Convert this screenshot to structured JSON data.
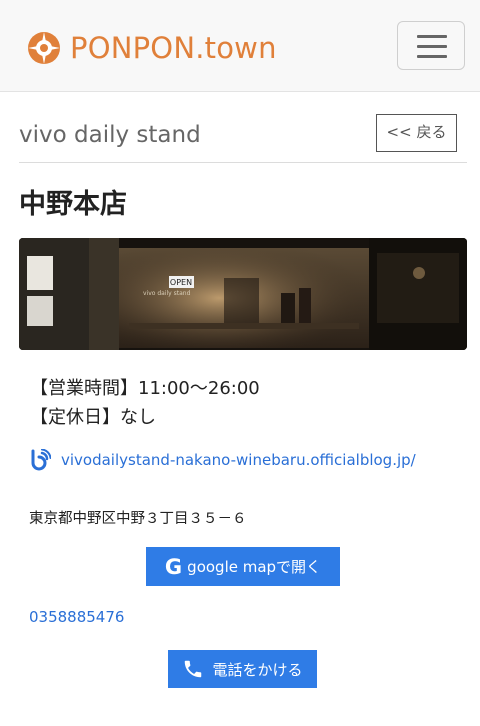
{
  "header": {
    "brand": "PONPON.town",
    "menu_icon": "hamburger-icon",
    "brand_color": "#e0803a"
  },
  "shop": {
    "name": "vivo daily stand",
    "back_label": "<< 戻る",
    "branch": "中野本店"
  },
  "info": {
    "hours": "【営業時間】11:00〜26:00",
    "closed": "【定休日】なし",
    "blog_url": "vivodailystand-nakano-winebaru.officialblog.jp/",
    "blog_icon": "blog-icon",
    "address": "東京都中野区中野３丁目３５－６",
    "map_button": "google mapで開く",
    "map_icon": "google-g-icon",
    "phone": "0358885476",
    "call_button": "電話をかける",
    "phone_icon": "phone-icon"
  },
  "photo_texts": {
    "open_sign": "OPEN",
    "window_text": "vivo daily stand"
  },
  "colors": {
    "accent": "#2f7ce6",
    "link": "#2a6fd6"
  }
}
